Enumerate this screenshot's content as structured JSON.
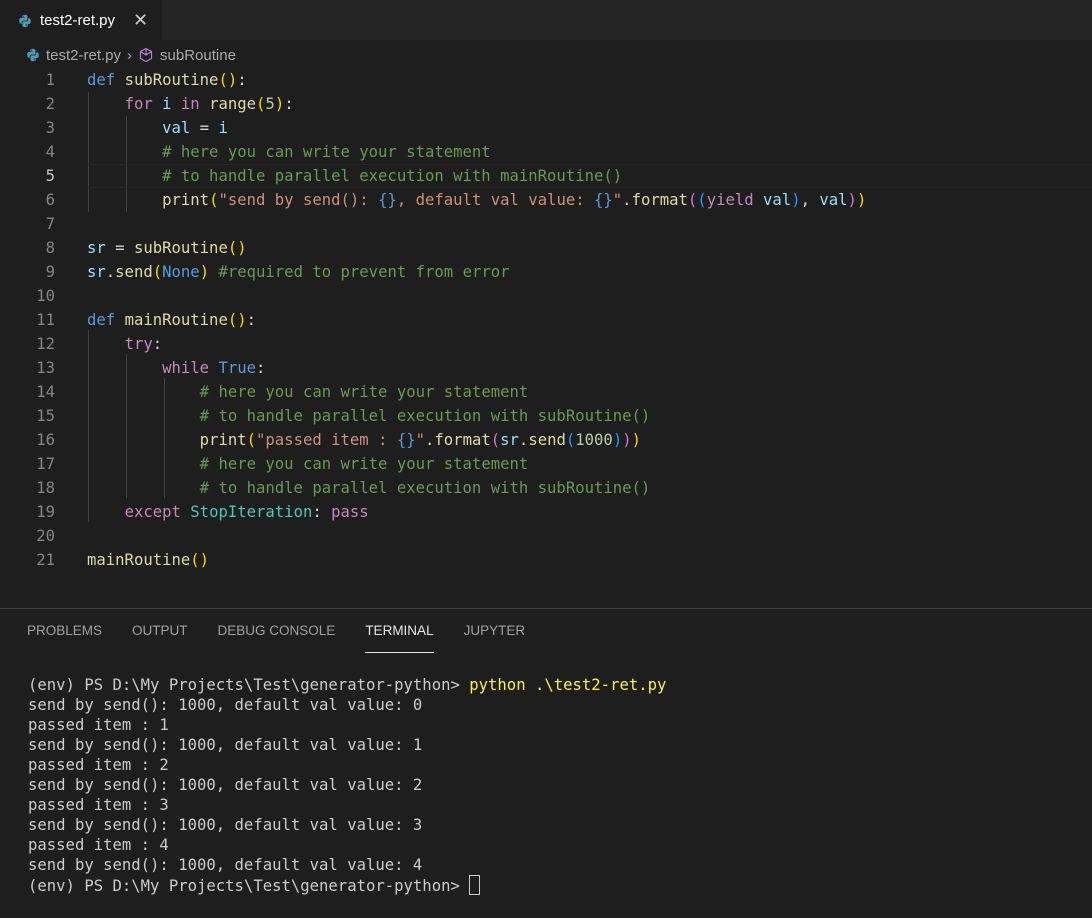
{
  "tab": {
    "filename": "test2-ret.py",
    "close_glyph": "✕"
  },
  "breadcrumb": {
    "file": "test2-ret.py",
    "separator": "›",
    "symbol": "subRoutine"
  },
  "editor": {
    "active_line": 5,
    "line_numbers": [
      "1",
      "2",
      "3",
      "4",
      "5",
      "6",
      "7",
      "8",
      "9",
      "10",
      "11",
      "12",
      "13",
      "14",
      "15",
      "16",
      "17",
      "18",
      "19",
      "20",
      "21"
    ]
  },
  "panel": {
    "tabs": [
      "PROBLEMS",
      "OUTPUT",
      "DEBUG CONSOLE",
      "TERMINAL",
      "JUPYTER"
    ],
    "active_tab": "TERMINAL"
  },
  "terminal": {
    "prompt": "(env) PS D:\\My Projects\\Test\\generator-python> ",
    "command": "python .\\test2-ret.py",
    "output": [
      "send by send(): 1000, default val value: 0",
      "passed item : 1",
      "send by send(): 1000, default val value: 1",
      "passed item : 2",
      "send by send(): 1000, default val value: 2",
      "passed item : 3",
      "send by send(): 1000, default val value: 3",
      "passed item : 4",
      "send by send(): 1000, default val value: 4"
    ],
    "final_prompt": "(env) PS D:\\My Projects\\Test\\generator-python> "
  },
  "colors": {
    "background": "#1e1e1e",
    "keyword": "#569cd6",
    "control": "#c586c0",
    "function": "#dcdcaa",
    "comment": "#6a9955",
    "string": "#ce9178",
    "command": "#f5f543"
  },
  "icons": [
    "python-file-icon",
    "symbol-method-icon",
    "close-icon"
  ]
}
